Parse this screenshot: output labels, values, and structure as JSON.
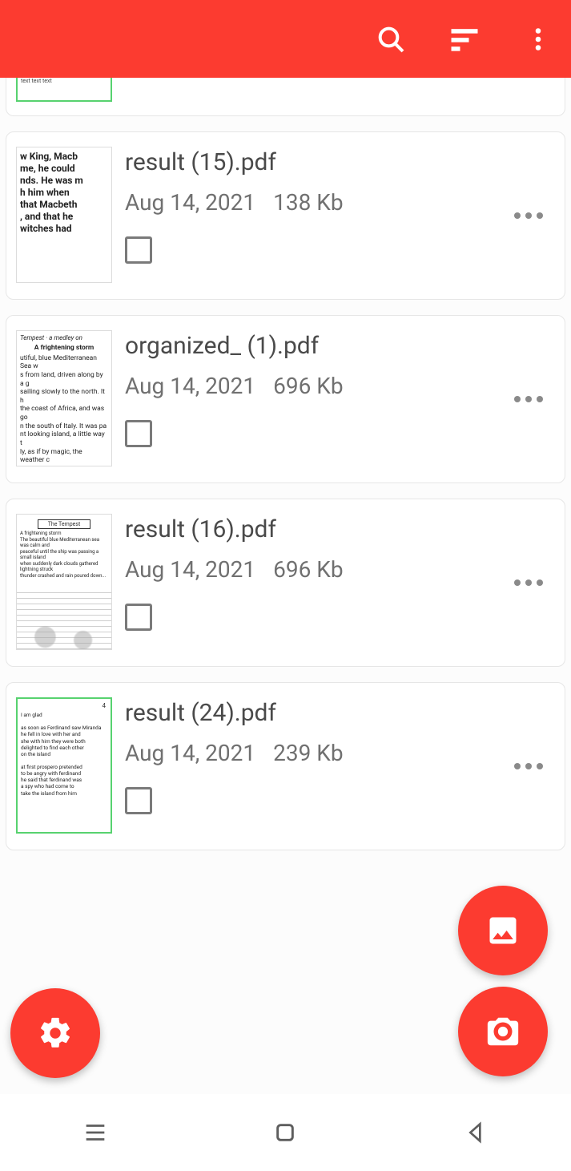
{
  "colors": {
    "accent": "#fc3b30"
  },
  "appbar": {
    "search_icon": "search-icon",
    "sort_icon": "sort-icon",
    "overflow_icon": "more-vert-icon"
  },
  "files": [
    {
      "name": "result (15).pdf",
      "date": "Aug 14, 2021",
      "size": "138 Kb",
      "checked": false,
      "thumb_style": "macbeth"
    },
    {
      "name": "organized_ (1).pdf",
      "date": "Aug 14, 2021",
      "size": "696 Kb",
      "checked": false,
      "thumb_style": "storm"
    },
    {
      "name": "result (16).pdf",
      "date": "Aug 14, 2021",
      "size": "696 Kb",
      "checked": false,
      "thumb_style": "tempest"
    },
    {
      "name": "result (24).pdf",
      "date": "Aug 14, 2021",
      "size": "239 Kb",
      "checked": false,
      "thumb_style": "page"
    }
  ],
  "fabs": {
    "settings": "settings-icon",
    "gallery": "image-icon",
    "camera": "camera-icon"
  },
  "navbar": {
    "recent": "recent-icon",
    "home": "square-icon",
    "back": "back-icon"
  }
}
